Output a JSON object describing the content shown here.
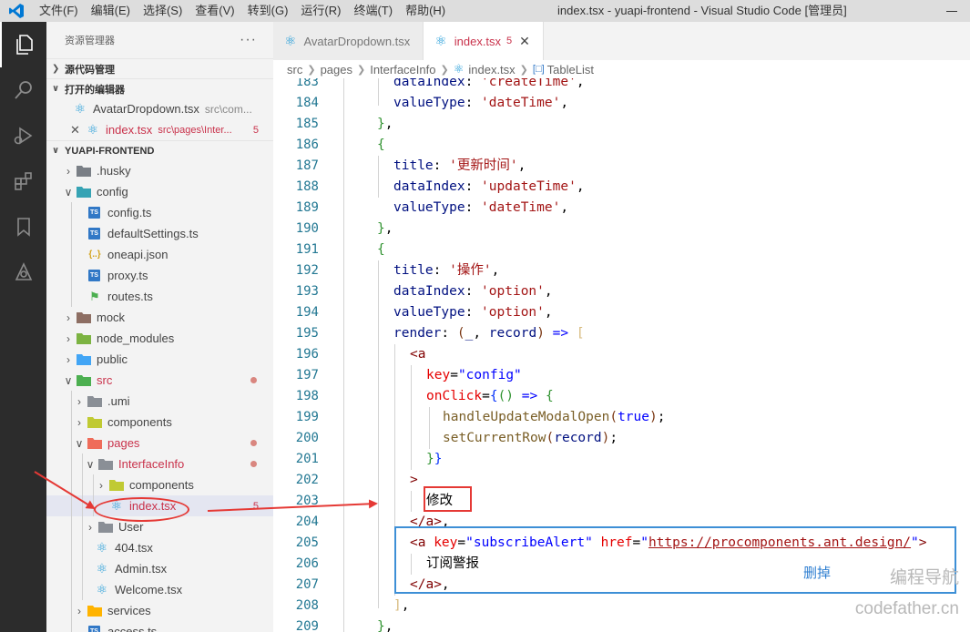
{
  "titlebar": {
    "menu": [
      "文件(F)",
      "编辑(E)",
      "选择(S)",
      "查看(V)",
      "转到(G)",
      "运行(R)",
      "终端(T)",
      "帮助(H)"
    ],
    "window_title": "index.tsx - yuapi-frontend - Visual Studio Code [管理员]"
  },
  "activitybar": {
    "icons": [
      "explorer-icon",
      "search-icon",
      "run-debug-icon",
      "extensions-icon",
      "bookmark-icon",
      "remote-icon"
    ]
  },
  "sidebar": {
    "header": "资源管理器",
    "more": "···",
    "sections": {
      "source_control": "源代码管理",
      "open_editors": "打开的编辑器",
      "project": "YUAPI-FRONTEND"
    },
    "open_editors": [
      {
        "name": "AvatarDropdown.tsx",
        "path": "src\\com..."
      },
      {
        "name": "index.tsx",
        "path": "src\\pages\\Inter...",
        "badge": "5"
      }
    ],
    "tree": [
      {
        "name": ".husky"
      },
      {
        "name": "config"
      },
      {
        "name": "config.ts"
      },
      {
        "name": "defaultSettings.ts"
      },
      {
        "name": "oneapi.json"
      },
      {
        "name": "proxy.ts"
      },
      {
        "name": "routes.ts"
      },
      {
        "name": "mock"
      },
      {
        "name": "node_modules"
      },
      {
        "name": "public"
      },
      {
        "name": "src"
      },
      {
        "name": ".umi"
      },
      {
        "name": "components"
      },
      {
        "name": "pages"
      },
      {
        "name": "InterfaceInfo"
      },
      {
        "name": "components"
      },
      {
        "name": "index.tsx",
        "badge": "5"
      },
      {
        "name": "User"
      },
      {
        "name": "404.tsx"
      },
      {
        "name": "Admin.tsx"
      },
      {
        "name": "Welcome.tsx"
      },
      {
        "name": "services"
      },
      {
        "name": "access.ts"
      }
    ]
  },
  "tabs": [
    {
      "label": "AvatarDropdown.tsx"
    },
    {
      "label": "index.tsx",
      "badge": "5"
    }
  ],
  "breadcrumb": [
    "src",
    "pages",
    "InterfaceInfo",
    "index.tsx",
    "TableList"
  ],
  "editor": {
    "line_numbers": [
      "183",
      "184",
      "185",
      "186",
      "187",
      "188",
      "189",
      "190",
      "191",
      "192",
      "193",
      "194",
      "195",
      "196",
      "197",
      "198",
      "199",
      "200",
      "201",
      "202",
      "203",
      "204",
      "205",
      "206",
      "207",
      "208",
      "209"
    ],
    "tokens": {
      "dataIndex": "dataIndex",
      "valueType": "valueType",
      "title": "title",
      "render": "render",
      "createTime": "'createTime'",
      "dateTime": "'dateTime'",
      "updateTitle": "'更新时间'",
      "updateTime": "'updateTime'",
      "opTitle": "'操作'",
      "option": "'option'",
      "record": "record",
      "key": "key",
      "config": "\"config\"",
      "onClick": "onClick",
      "handleUpdateModalOpen": "handleUpdateModalOpen",
      "true": "true",
      "setCurrentRow": "setCurrentRow",
      "modify": "修改",
      "subscribeAlert": "\"subscribeAlert\"",
      "href": "href",
      "url": "https://procomponents.ant.design/",
      "subscribeText": "订阅警报"
    }
  },
  "annotations": {
    "delete_label": "删掉"
  },
  "watermark": {
    "line1": "编程导航",
    "line2": "codefather.cn"
  }
}
